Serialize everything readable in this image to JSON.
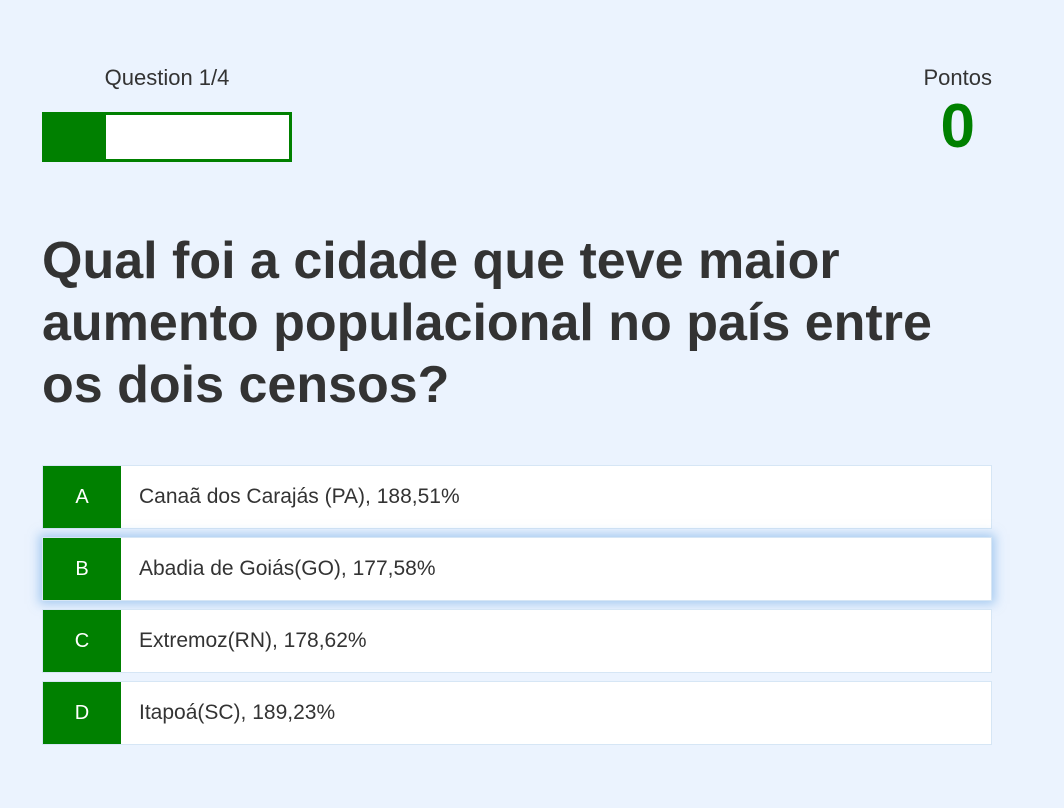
{
  "hud": {
    "question_label": "Question 1/4",
    "progress_fraction": 0.25,
    "score_label": "Pontos",
    "score_value": "0"
  },
  "question": {
    "text": "Qual foi a cidade que teve maior aumento populacional no país entre os dois censos?"
  },
  "choices": [
    {
      "prefix": "A",
      "text": "Canaã dos Carajás (PA), 188,51%"
    },
    {
      "prefix": "B",
      "text": "Abadia de Goiás(GO), 177,58%"
    },
    {
      "prefix": "C",
      "text": "Extremoz(RN), 178,62%"
    },
    {
      "prefix": "D",
      "text": "Itapoá(SC), 189,23%"
    }
  ],
  "colors": {
    "accent": "#008000",
    "background": "#ebf3fe",
    "text": "#333333",
    "hover_glow": "#6eaae6"
  },
  "state": {
    "hovered_choice": "B"
  }
}
